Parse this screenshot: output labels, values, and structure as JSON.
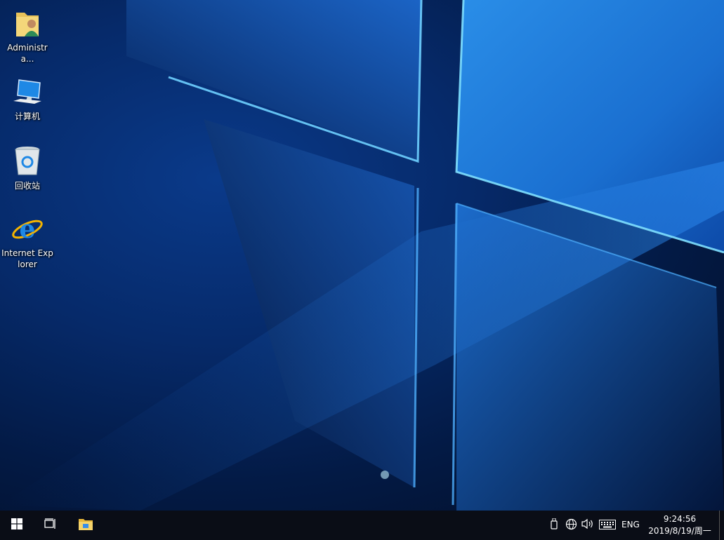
{
  "desktop": {
    "icons": [
      {
        "label": "Administra...",
        "icon": "user-folder-icon"
      },
      {
        "label": "计算机",
        "icon": "computer-icon"
      },
      {
        "label": "回收站",
        "icon": "recycle-bin-icon"
      },
      {
        "label": "Internet Explorer",
        "icon": "internet-explorer-icon"
      }
    ]
  },
  "taskbar": {
    "start_icon": "windows-logo-icon",
    "task_view_icon": "task-view-icon",
    "pinned_icon": "file-explorer-icon",
    "tray": {
      "icons": [
        "usb-drive-icon",
        "network-globe-icon",
        "volume-icon",
        "keyboard-icon"
      ],
      "language": "ENG",
      "time": "9:24:56",
      "date": "2019/8/19/周一"
    }
  },
  "colors": {
    "accent": "#1e90ff",
    "taskbar": "#0a0d16",
    "wallpaper_dark": "#020c22"
  }
}
